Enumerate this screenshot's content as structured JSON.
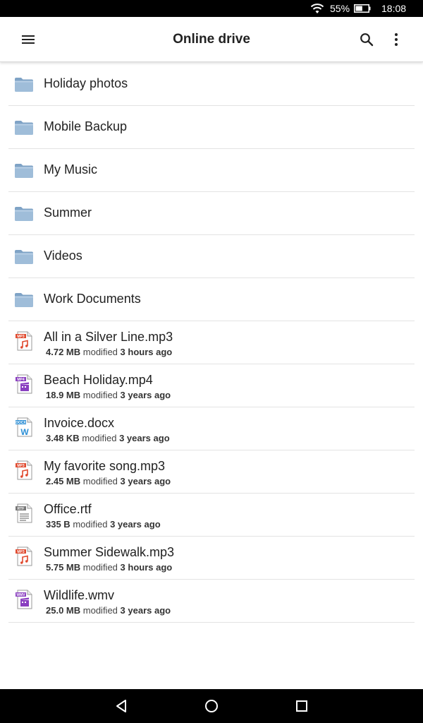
{
  "status_bar": {
    "battery_percent": "55%",
    "battery_level": 0.55,
    "time": "18:08",
    "wifi_icon": "wifi-icon",
    "battery_icon": "battery-icon"
  },
  "app_bar": {
    "title": "Online drive",
    "menu_icon": "menu-icon",
    "search_icon": "search-icon",
    "more_icon": "more-vert-icon"
  },
  "folders": [
    {
      "name": "Holiday photos"
    },
    {
      "name": "Mobile Backup"
    },
    {
      "name": "My Music"
    },
    {
      "name": "Summer"
    },
    {
      "name": "Videos"
    },
    {
      "name": "Work Documents"
    }
  ],
  "files": [
    {
      "name": "All in a Silver Line.mp3",
      "size": "4.72 MB",
      "modified_label": "modified",
      "modified": "3 hours ago",
      "type": "MP3",
      "icon": "mp3-file-icon"
    },
    {
      "name": "Beach Holiday.mp4",
      "size": "18.9 MB",
      "modified_label": "modified",
      "modified": "3 years ago",
      "type": "MP4",
      "icon": "mp4-file-icon"
    },
    {
      "name": "Invoice.docx",
      "size": "3.48 KB",
      "modified_label": "modified",
      "modified": "3 years ago",
      "type": "DOCX",
      "icon": "docx-file-icon"
    },
    {
      "name": "My favorite song.mp3",
      "size": "2.45 MB",
      "modified_label": "modified",
      "modified": "3 years ago",
      "type": "MP3",
      "icon": "mp3-file-icon"
    },
    {
      "name": "Office.rtf",
      "size": "335 B",
      "modified_label": "modified",
      "modified": "3 years ago",
      "type": "RTF",
      "icon": "rtf-file-icon"
    },
    {
      "name": "Summer Sidewalk.mp3",
      "size": "5.75 MB",
      "modified_label": "modified",
      "modified": "3 hours ago",
      "type": "MP3",
      "icon": "mp3-file-icon"
    },
    {
      "name": "Wildlife.wmv",
      "size": "25.0 MB",
      "modified_label": "modified",
      "modified": "3 years ago",
      "type": "WMV",
      "icon": "wmv-file-icon"
    }
  ],
  "colors": {
    "folder_blue": "#9fbdd9",
    "mp3_red": "#e04a2f",
    "video_purple": "#8a3fc0",
    "docx_blue": "#2d8fd5",
    "rtf_gray": "#777777"
  },
  "nav_bar": {
    "back_icon": "back-triangle-icon",
    "home_icon": "home-circle-icon",
    "recents_icon": "recents-square-icon"
  }
}
